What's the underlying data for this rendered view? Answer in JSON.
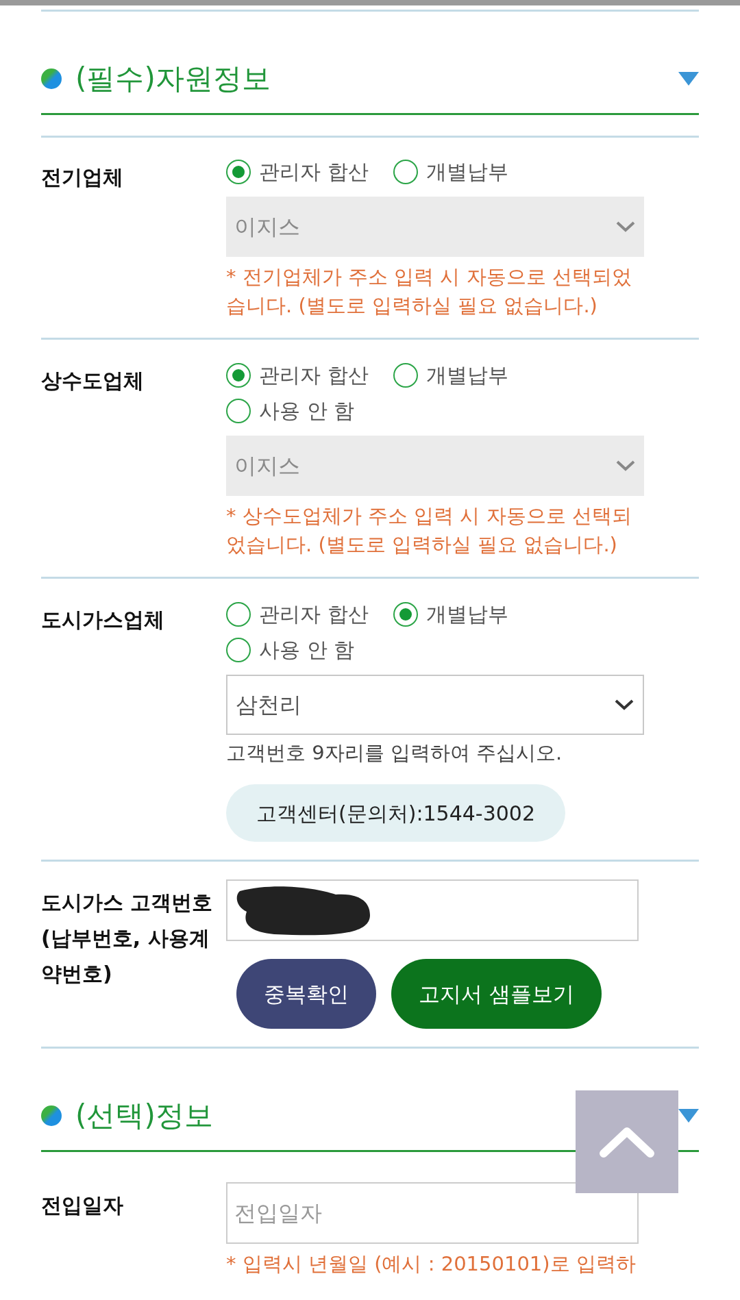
{
  "sections": [
    {
      "title": "(필수)자원정보",
      "expanded": true,
      "fields": [
        {
          "label": "전기업체",
          "options": [
            {
              "label": "관리자 합산",
              "selected": true
            },
            {
              "label": "개별납부",
              "selected": false
            }
          ],
          "select": {
            "value": "이지스",
            "disabled": true
          },
          "note": "* 전기업체가 주소 입력 시 자동으로 선택되었습니다. (별도로 입력하실 필요 없습니다.)"
        },
        {
          "label": "상수도업체",
          "options": [
            {
              "label": "관리자 합산",
              "selected": true
            },
            {
              "label": "개별납부",
              "selected": false
            },
            {
              "label": "사용 안 함",
              "selected": false
            }
          ],
          "select": {
            "value": "이지스",
            "disabled": true
          },
          "note": "* 상수도업체가 주소 입력 시 자동으로 선택되었습니다. (별도로 입력하실 필요 없습니다.)"
        },
        {
          "label": "도시가스업체",
          "options": [
            {
              "label": "관리자 합산",
              "selected": false
            },
            {
              "label": "개별납부",
              "selected": true
            },
            {
              "label": "사용 안 함",
              "selected": false
            }
          ],
          "select": {
            "value": "삼천리",
            "disabled": false
          },
          "help": "고객번호 9자리를 입력하여 주십시오.",
          "buttons": [
            {
              "label": "고객센터(문의처):1544-3002",
              "kind": "info"
            }
          ]
        },
        {
          "label": "도시가스 고객번호\n(납부번호, 사용계약번호)",
          "input": {
            "redacted": true
          },
          "buttons": [
            {
              "label": "중복확인",
              "kind": "primary"
            },
            {
              "label": "고지서 샘플보기",
              "kind": "success"
            }
          ]
        }
      ]
    },
    {
      "title": "(선택)정보",
      "expanded": true,
      "fields": [
        {
          "label": "전입일자",
          "input": {
            "placeholder": "전입일자",
            "redacted": false
          },
          "note": "* 입력시 년월일 (예시 : 20150101)로 입력하"
        }
      ]
    }
  ]
}
